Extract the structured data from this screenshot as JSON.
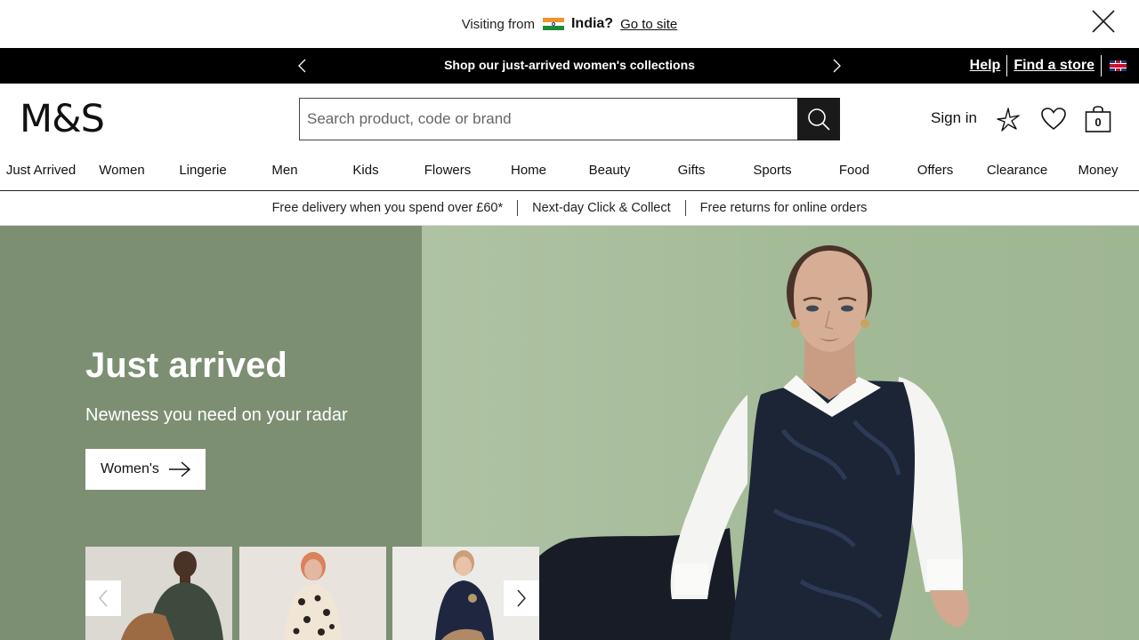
{
  "country_banner": {
    "visiting_label": "Visiting from",
    "country": "India?",
    "goto_label": "Go to site"
  },
  "promo": {
    "message": "Shop our just-arrived women's collections",
    "help": "Help",
    "find_store": "Find a store"
  },
  "header": {
    "logo": "M&S",
    "search_placeholder": "Search product, code or brand",
    "sign_in": "Sign in",
    "bag_count": "0"
  },
  "nav": {
    "items": [
      "Just Arrived",
      "Women",
      "Lingerie",
      "Men",
      "Kids",
      "Flowers",
      "Home",
      "Beauty",
      "Gifts",
      "Sports",
      "Food",
      "Offers",
      "Clearance",
      "Money"
    ]
  },
  "service": {
    "items": [
      "Free delivery when you spend over £60*",
      "Next-day Click & Collect",
      "Free returns for online orders"
    ]
  },
  "hero": {
    "title": "Just arrived",
    "subtitle": "Newness you need on your radar",
    "button_label": "Women's"
  },
  "colors": {
    "hero_left": "#7c8f73",
    "hero_right": "#afc3a4",
    "promo_bg": "#000000",
    "search_button": "#1a1a1a"
  },
  "icons": [
    "close-icon",
    "chevron-left-icon",
    "chevron-right-icon",
    "search-icon",
    "sparkle-icon",
    "heart-icon",
    "bag-icon",
    "arrow-right-icon"
  ]
}
